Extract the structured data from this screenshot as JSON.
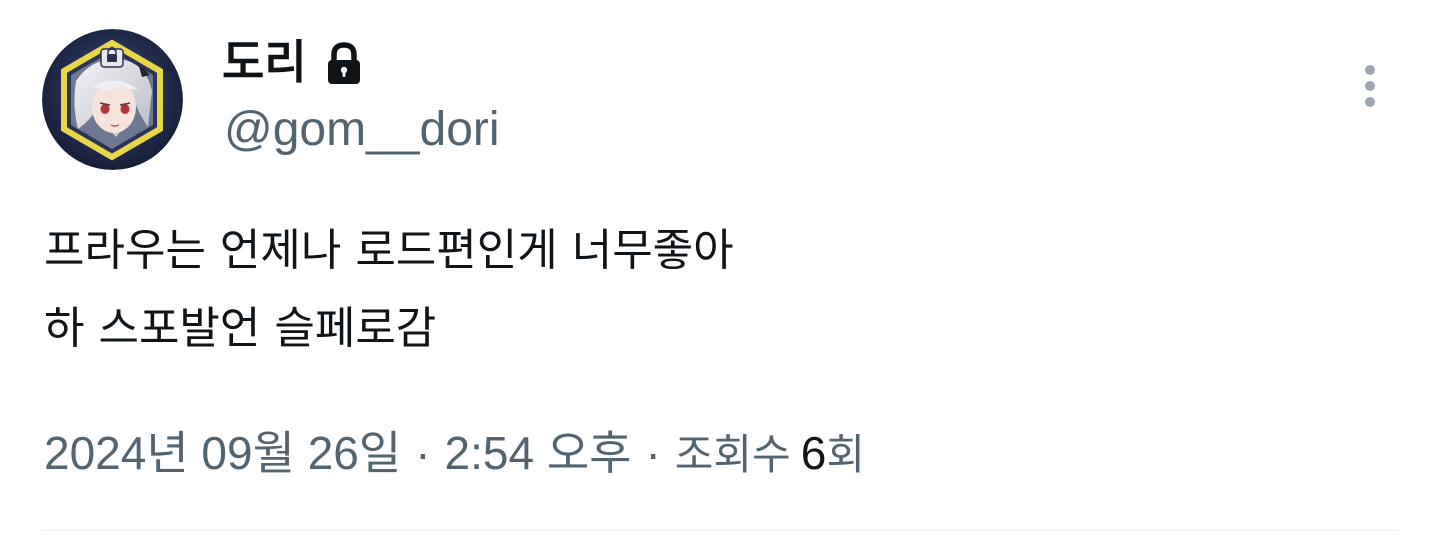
{
  "author": {
    "display_name": "도리",
    "handle": "@gom__dori",
    "avatar": "avatar-anime-portrait",
    "protected_icon": "lock-icon"
  },
  "more_menu_icon": "more-vertical-icon",
  "tweet": {
    "lines": [
      "프라우는 언제나 로드편인게 너무좋아",
      "하 스포발언 슬페로감"
    ]
  },
  "meta": {
    "date": "2024년 09월 26일",
    "separator": "·",
    "time": "2:54 오후",
    "views_label": "조회수",
    "views_count": "6",
    "views_suffix": "회"
  },
  "colors": {
    "text_primary": "#0f1419",
    "text_secondary": "#536471",
    "divider": "#eff3f4",
    "avatar_frame": "#e8d54a"
  }
}
